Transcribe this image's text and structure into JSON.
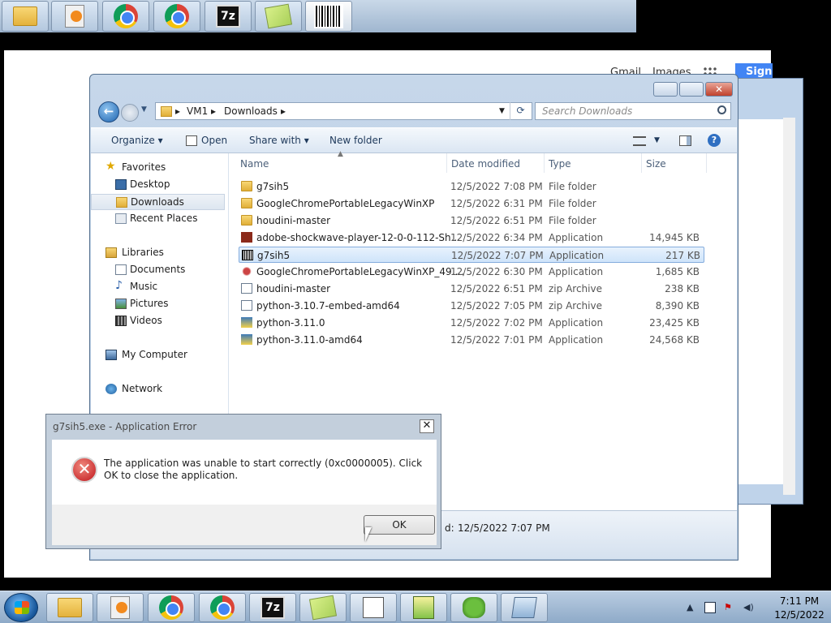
{
  "top_strip": {
    "buttons": [
      "folder-icon",
      "media-player-icon",
      "chrome-icon",
      "chrome-icon",
      "7zip-icon",
      "sticky-notes-icon",
      "barcode-app-icon"
    ]
  },
  "web_page": {
    "gmail": "Gmail",
    "images": "Images",
    "sign_in": "Sign in"
  },
  "explorer": {
    "close_label": "✕",
    "breadcrumb": [
      "VM1",
      "Downloads"
    ],
    "search_placeholder": "Search Downloads",
    "toolbar": {
      "organize": "Organize",
      "open": "Open",
      "share_with": "Share with",
      "new_folder": "New folder"
    },
    "nav": {
      "favorites": "Favorites",
      "desktop": "Desktop",
      "downloads": "Downloads",
      "recent_places": "Recent Places",
      "libraries": "Libraries",
      "documents": "Documents",
      "music": "Music",
      "pictures": "Pictures",
      "videos": "Videos",
      "my_computer": "My Computer",
      "network": "Network"
    },
    "columns": {
      "name": "Name",
      "date": "Date modified",
      "type": "Type",
      "size": "Size"
    },
    "rows": [
      {
        "name": "g7sih5",
        "date": "12/5/2022 7:08 PM",
        "type": "File folder",
        "size": ""
      },
      {
        "name": "GoogleChromePortableLegacyWinXP",
        "date": "12/5/2022 6:31 PM",
        "type": "File folder",
        "size": ""
      },
      {
        "name": "houdini-master",
        "date": "12/5/2022 6:51 PM",
        "type": "File folder",
        "size": ""
      },
      {
        "name": "adobe-shockwave-player-12-0-0-112-Sh...",
        "date": "12/5/2022 6:34 PM",
        "type": "Application",
        "size": "14,945 KB"
      },
      {
        "name": "g7sih5",
        "date": "12/5/2022 7:07 PM",
        "type": "Application",
        "size": "217 KB"
      },
      {
        "name": "GoogleChromePortableLegacyWinXP_49....",
        "date": "12/5/2022 6:30 PM",
        "type": "Application",
        "size": "1,685 KB"
      },
      {
        "name": "houdini-master",
        "date": "12/5/2022 6:51 PM",
        "type": "zip Archive",
        "size": "238 KB"
      },
      {
        "name": "python-3.10.7-embed-amd64",
        "date": "12/5/2022 7:05 PM",
        "type": "zip Archive",
        "size": "8,390 KB"
      },
      {
        "name": "python-3.11.0",
        "date": "12/5/2022 7:02 PM",
        "type": "Application",
        "size": "23,425 KB"
      },
      {
        "name": "python-3.11.0-amd64",
        "date": "12/5/2022 7:01 PM",
        "type": "Application",
        "size": "24,568 KB"
      }
    ],
    "details": {
      "label": "d:",
      "date": "12/5/2022 7:07 PM"
    }
  },
  "dialog": {
    "title": "g7sih5.exe - Application Error",
    "close": "✕",
    "message": "The application was unable to start correctly (0xc0000005). Click OK to close the application.",
    "ok": "OK"
  },
  "taskbar": {
    "clock_time": "7:11 PM",
    "clock_date": "12/5/2022"
  }
}
